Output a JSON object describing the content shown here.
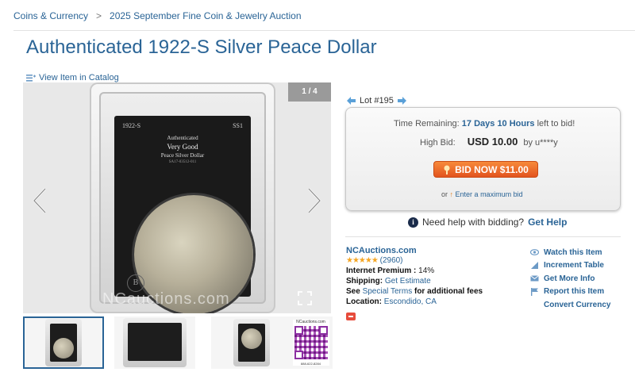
{
  "breadcrumb": {
    "items": [
      "Coins & Currency",
      "2025 September Fine Coin & Jewelry Auction"
    ],
    "separator": ">"
  },
  "title": "Authenticated 1922-S Silver Peace Dollar",
  "catalog_link": "View Item in Catalog",
  "gallery": {
    "counter": "1 / 4",
    "slab_label": {
      "year": "1922-S",
      "grade_code": "SS1",
      "authenticated": "Authenticated",
      "grade": "Very Good",
      "type": "Peace Silver Dollar",
      "serial": "SA17-03512-011"
    },
    "watermark": "NCauctions.com",
    "slab_mark": "B"
  },
  "thumbnails": {
    "qr_title": "NCauctions.com",
    "qr_phone": "888-622-8284"
  },
  "lot": {
    "label": "Lot #195"
  },
  "bid": {
    "time_label": "Time Remaining:",
    "time_value": "17 Days 10 Hours",
    "time_suffix": "left to bid!",
    "high_label": "High Bid:",
    "high_amount": "USD 10.00",
    "high_by": "by u****y",
    "button_label": "BID NOW $11.00",
    "max_prefix": "or",
    "max_link": "Enter a maximum bid"
  },
  "help": {
    "text": "Need help with bidding?",
    "link": "Get Help"
  },
  "seller": {
    "name": "NCAuctions.com",
    "stars": "★★★★★",
    "rating_count": "(2960)",
    "premium_label": "Internet Premium :",
    "premium_value": "14%",
    "shipping_label": "Shipping:",
    "shipping_value": "Get Estimate",
    "terms_prefix": "See",
    "terms_link": "Special Terms",
    "terms_suffix": "for additional fees",
    "location_label": "Location:",
    "location_value": "Escondido, CA"
  },
  "actions": [
    {
      "label": "Watch this Item",
      "icon": "eye-icon"
    },
    {
      "label": "Increment Table",
      "icon": "increment-icon"
    },
    {
      "label": "Get More Info",
      "icon": "mail-icon"
    },
    {
      "label": "Report this Item",
      "icon": "flag-icon"
    },
    {
      "label": "Convert Currency",
      "icon": ""
    }
  ],
  "colors": {
    "link": "#2a6496",
    "bid_button": "#e8602a",
    "stars": "#f5a623"
  }
}
